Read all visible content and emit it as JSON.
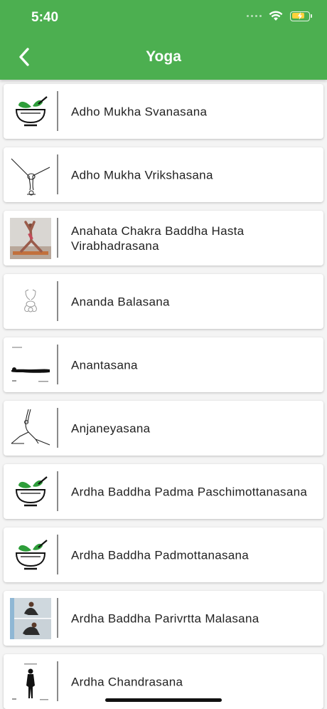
{
  "status_bar": {
    "time": "5:40",
    "battery_charging": true
  },
  "nav": {
    "title": "Yoga",
    "back_icon": "chevron-left-icon"
  },
  "colors": {
    "header": "#4caf50",
    "text": "#222222",
    "leaf": "#2e9e3a"
  },
  "poses": [
    {
      "name": "Adho Mukha Svanasana",
      "thumb": "mortar-leaf-icon"
    },
    {
      "name": "Adho Mukha Vrikshasana",
      "thumb": "handstand-sketch"
    },
    {
      "name": "Anahata Chakra Baddha Hasta Virabhadrasana",
      "thumb": "photo-warrior-pose"
    },
    {
      "name": "Ananda Balasana",
      "thumb": "happy-baby-sketch"
    },
    {
      "name": "Anantasana",
      "thumb": "lying-figure-card"
    },
    {
      "name": "Anjaneyasana",
      "thumb": "crescent-lunge-sketch"
    },
    {
      "name": "Ardha Baddha Padma Paschimottanasana",
      "thumb": "mortar-leaf-icon"
    },
    {
      "name": "Ardha Baddha Padmottanasana",
      "thumb": "mortar-leaf-icon"
    },
    {
      "name": "Ardha Baddha Parivrtta Malasana",
      "thumb": "photo-squat-twist"
    },
    {
      "name": "Ardha Chandrasana",
      "thumb": "standing-figure-card"
    }
  ]
}
